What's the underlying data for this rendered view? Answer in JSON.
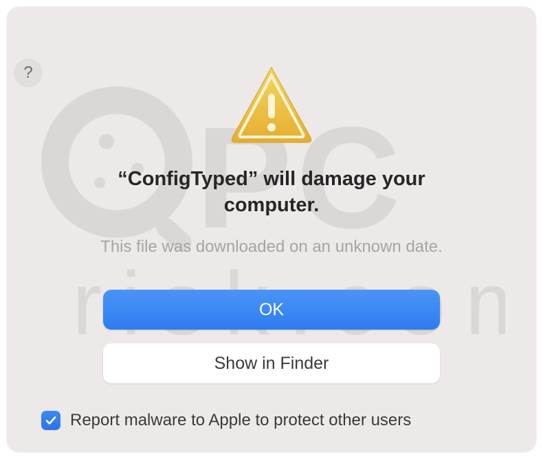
{
  "dialog": {
    "title": "“ConfigTyped” will damage your computer.",
    "subtitle": "This file was downloaded on an unknown date.",
    "ok_label": "OK",
    "show_in_finder_label": "Show in Finder",
    "checkbox_label": "Report malware to Apple to protect other users",
    "checkbox_checked": true
  },
  "colors": {
    "primary": "#3a82f1",
    "background": "#ece9e8",
    "text_primary": "#262626",
    "text_secondary": "#a8a4a3"
  },
  "icons": {
    "warning": "warning-triangle",
    "help": "question-mark",
    "check": "checkmark"
  }
}
